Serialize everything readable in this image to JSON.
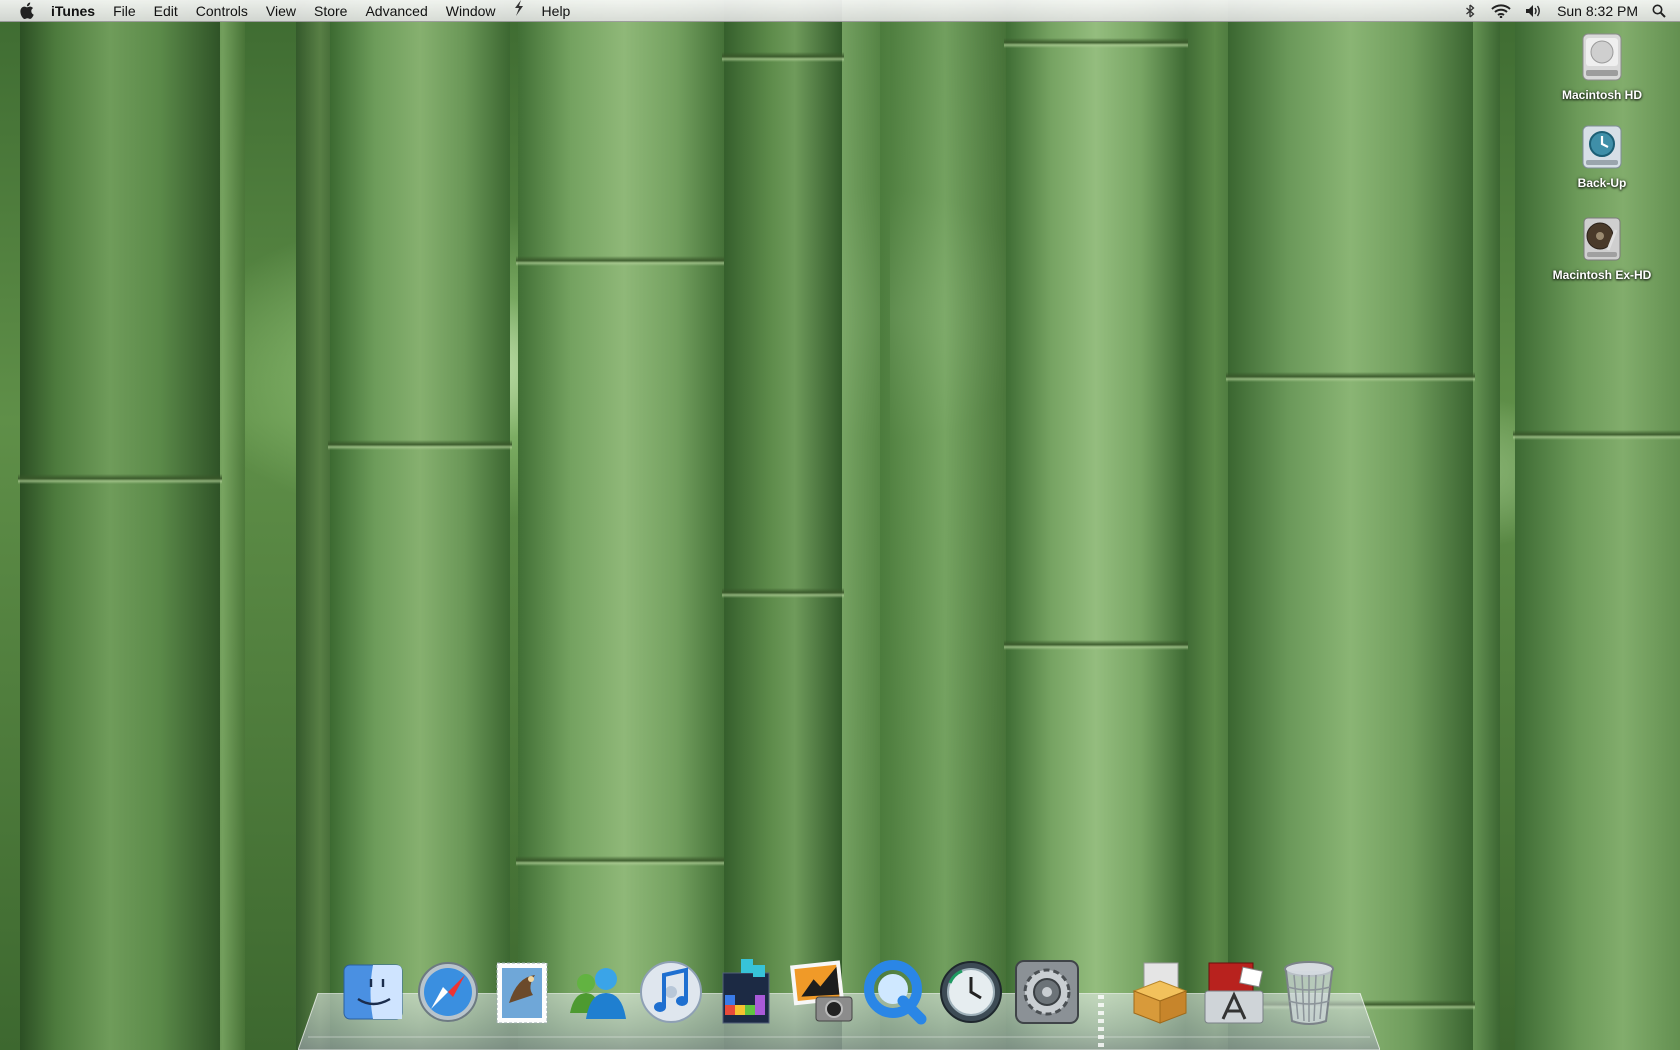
{
  "menubar": {
    "app_name": "iTunes",
    "items": [
      "File",
      "Edit",
      "Controls",
      "View",
      "Store",
      "Advanced",
      "Window",
      "Help"
    ],
    "clock": "Sun 8:32 PM"
  },
  "desktop_icons": [
    {
      "label": "Macintosh HD",
      "icon": "hard-drive-icon"
    },
    {
      "label": "Back-Up",
      "icon": "time-machine-drive-icon"
    },
    {
      "label": "Macintosh Ex-HD",
      "icon": "external-hard-drive-icon"
    }
  ],
  "dock": {
    "apps": [
      "finder-icon",
      "safari-icon",
      "mail-icon",
      "messenger-icon",
      "itunes-icon",
      "tetris-icon",
      "iphoto-icon",
      "quicktime-icon",
      "time-machine-icon",
      "system-preferences-icon"
    ],
    "stacks": [
      "packages-stack-icon",
      "applications-stack-icon",
      "trash-icon"
    ]
  }
}
